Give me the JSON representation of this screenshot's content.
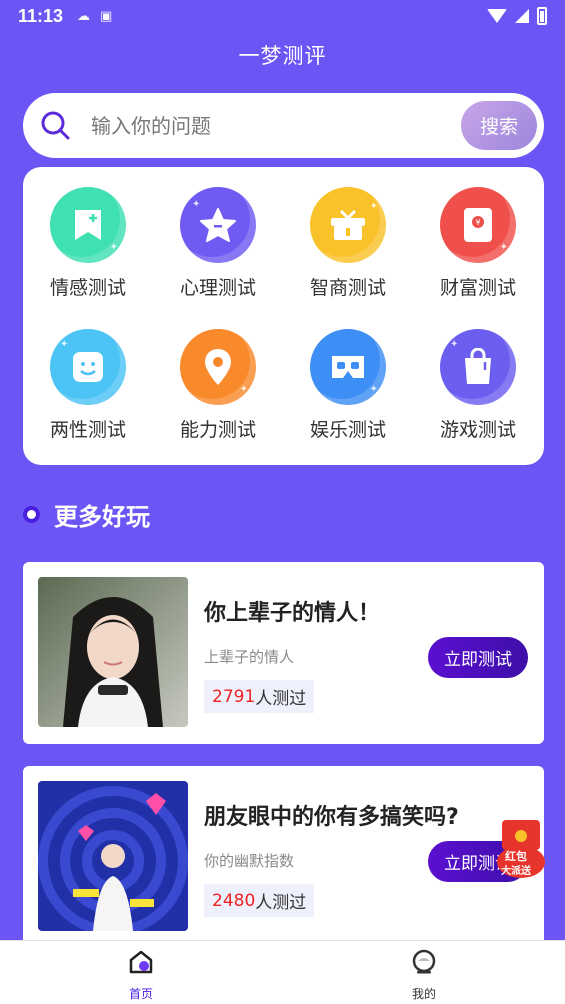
{
  "status": {
    "time": "11:13"
  },
  "app": {
    "title": "一梦测评"
  },
  "search": {
    "placeholder": "输入你的问题",
    "button": "搜索"
  },
  "categories": [
    {
      "label": "情感测试",
      "icon": "bookmark-icon",
      "color": "#3fe0b2"
    },
    {
      "label": "心理测试",
      "icon": "star-icon",
      "color": "#6f5bf2"
    },
    {
      "label": "智商测试",
      "icon": "gift-box-icon",
      "color": "#f9c12a"
    },
    {
      "label": "财富测试",
      "icon": "red-envelope-icon",
      "color": "#f0504b"
    },
    {
      "label": "两性测试",
      "icon": "smiley-icon",
      "color": "#4cc3f5"
    },
    {
      "label": "能力测试",
      "icon": "location-pin-icon",
      "color": "#f98a2c"
    },
    {
      "label": "娱乐测试",
      "icon": "vr-glasses-icon",
      "color": "#3d8ef5"
    },
    {
      "label": "游戏测试",
      "icon": "shopping-bag-icon",
      "color": "#6c5ff0"
    }
  ],
  "section": {
    "title": "更多好玩"
  },
  "quizzes": [
    {
      "title": "你上辈子的情人！",
      "subtitle": "上辈子的情人",
      "count": "2791",
      "count_suffix": "人测过",
      "button": "立即测试"
    },
    {
      "title": "朋友眼中的你有多搞笑吗?",
      "subtitle": "你的幽默指数",
      "count": "2480",
      "count_suffix": "人测过",
      "button": "立即测试"
    }
  ],
  "floating": {
    "line1": "红包",
    "line2": "大派送"
  },
  "tabs": [
    {
      "label": "首页",
      "active": true
    },
    {
      "label": "我的",
      "active": false
    }
  ],
  "colors": {
    "background": "#6c55f5",
    "accent": "#4a1fe0",
    "count_red": "#e22222"
  }
}
